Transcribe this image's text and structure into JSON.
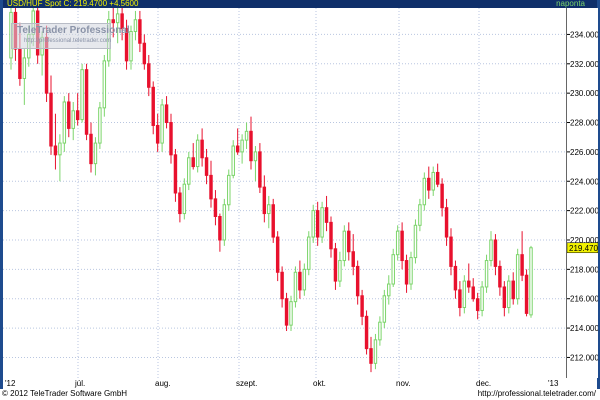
{
  "header": {
    "title": "USD/HUF Spot C: 219.4700 +4.5600",
    "period": "naponta"
  },
  "watermark": {
    "name": "TeleTrader Professional",
    "url": "http://professional.teletrader.com"
  },
  "footer": {
    "copyright": "© 2012 TeleTrader Software GmbH",
    "url": "http://professional.teletrader.com/"
  },
  "colors": {
    "frame": "#1e4b8e",
    "up": "#7cd56b",
    "down": "#e8112d",
    "grid": "#b9c6e0",
    "last_price_box": "#f2f200"
  },
  "chart_data": {
    "type": "candlestick",
    "title": "USD/HUF Spot C: 219.4700 +4.5600",
    "ylim": [
      210.6,
      235.8
    ],
    "y_ticks": [
      212,
      214,
      216,
      218,
      220,
      222,
      224,
      226,
      228,
      230,
      232,
      234
    ],
    "y_tick_labels": [
      "212.0000",
      "214.0000",
      "216.0000",
      "218.0000",
      "220.0000",
      "222.0000",
      "224.0000",
      "226.0000",
      "228.0000",
      "230.0000",
      "232.0000",
      "234.0000"
    ],
    "x_tick_labels": [
      "'12",
      "júl.",
      "aug.",
      "szept.",
      "okt.",
      "nov.",
      "dec.",
      "'13"
    ],
    "grid": true,
    "last_price": 219.47,
    "last_price_label": "219.4700",
    "candles": [
      [
        232.4,
        236.2,
        231.6,
        235.5
      ],
      [
        235.5,
        236.4,
        232.2,
        233.0
      ],
      [
        233.0,
        234.8,
        230.5,
        231.0
      ],
      [
        231.0,
        233.0,
        229.2,
        232.4
      ],
      [
        232.4,
        234.6,
        231.8,
        234.0
      ],
      [
        234.0,
        236.0,
        233.2,
        235.6
      ],
      [
        235.6,
        236.0,
        232.0,
        232.6
      ],
      [
        232.6,
        234.2,
        231.2,
        233.8
      ],
      [
        233.8,
        234.6,
        229.4,
        230.0
      ],
      [
        230.0,
        231.2,
        225.8,
        226.4
      ],
      [
        226.4,
        228.6,
        224.8,
        225.8
      ],
      [
        225.8,
        227.2,
        224.0,
        226.6
      ],
      [
        226.6,
        229.8,
        226.0,
        229.4
      ],
      [
        229.4,
        230.0,
        227.0,
        227.6
      ],
      [
        227.6,
        229.4,
        226.8,
        228.8
      ],
      [
        228.8,
        230.0,
        227.8,
        228.2
      ],
      [
        228.2,
        232.0,
        228.0,
        231.6
      ],
      [
        231.6,
        232.0,
        226.8,
        227.2
      ],
      [
        227.2,
        228.0,
        224.6,
        225.2
      ],
      [
        225.2,
        227.0,
        224.4,
        226.6
      ],
      [
        226.6,
        229.4,
        226.2,
        229.0
      ],
      [
        229.0,
        232.6,
        228.4,
        232.2
      ],
      [
        232.2,
        235.6,
        231.8,
        235.0
      ],
      [
        235.0,
        236.0,
        233.8,
        234.8
      ],
      [
        234.8,
        236.0,
        233.4,
        235.4
      ],
      [
        235.4,
        236.2,
        233.6,
        234.4
      ],
      [
        234.4,
        235.0,
        231.6,
        232.2
      ],
      [
        232.2,
        234.6,
        231.6,
        234.2
      ],
      [
        234.2,
        235.6,
        233.6,
        235.0
      ],
      [
        235.0,
        235.6,
        232.8,
        233.4
      ],
      [
        233.4,
        234.0,
        231.6,
        232.0
      ],
      [
        232.0,
        232.6,
        229.8,
        230.4
      ],
      [
        230.4,
        230.8,
        227.2,
        227.8
      ],
      [
        227.8,
        228.6,
        226.0,
        226.6
      ],
      [
        226.6,
        229.6,
        226.0,
        229.2
      ],
      [
        229.2,
        229.8,
        227.6,
        228.0
      ],
      [
        228.0,
        228.6,
        225.2,
        225.8
      ],
      [
        225.8,
        226.2,
        222.6,
        223.2
      ],
      [
        223.2,
        223.6,
        221.2,
        221.8
      ],
      [
        221.8,
        224.2,
        221.4,
        223.8
      ],
      [
        223.8,
        226.0,
        223.4,
        225.6
      ],
      [
        225.6,
        226.6,
        224.8,
        225.0
      ],
      [
        225.0,
        227.2,
        224.6,
        226.8
      ],
      [
        226.8,
        227.6,
        225.0,
        225.6
      ],
      [
        225.6,
        226.2,
        223.8,
        224.4
      ],
      [
        224.4,
        225.4,
        222.2,
        222.8
      ],
      [
        222.8,
        223.4,
        221.0,
        221.6
      ],
      [
        221.6,
        221.8,
        219.2,
        220.0
      ],
      [
        220.0,
        222.8,
        219.6,
        222.4
      ],
      [
        222.4,
        224.8,
        222.0,
        224.4
      ],
      [
        224.4,
        226.8,
        224.2,
        226.4
      ],
      [
        226.4,
        227.6,
        225.8,
        226.0
      ],
      [
        226.0,
        227.2,
        225.2,
        226.8
      ],
      [
        226.8,
        228.0,
        226.2,
        227.4
      ],
      [
        227.4,
        228.4,
        224.8,
        225.4
      ],
      [
        225.4,
        226.4,
        224.0,
        226.0
      ],
      [
        226.0,
        226.6,
        223.2,
        223.6
      ],
      [
        223.6,
        224.4,
        221.2,
        221.8
      ],
      [
        221.8,
        223.0,
        220.8,
        222.4
      ],
      [
        222.4,
        222.8,
        219.8,
        220.2
      ],
      [
        220.2,
        220.6,
        217.2,
        217.8
      ],
      [
        217.8,
        218.2,
        215.4,
        216.0
      ],
      [
        216.0,
        216.4,
        213.8,
        214.2
      ],
      [
        214.2,
        216.2,
        213.8,
        215.8
      ],
      [
        215.8,
        218.2,
        215.4,
        217.8
      ],
      [
        217.8,
        218.6,
        216.0,
        216.6
      ],
      [
        216.6,
        218.4,
        216.2,
        218.0
      ],
      [
        218.0,
        220.6,
        217.6,
        220.2
      ],
      [
        220.2,
        222.4,
        219.8,
        222.0
      ],
      [
        222.0,
        222.6,
        219.6,
        220.2
      ],
      [
        220.2,
        222.6,
        219.8,
        222.2
      ],
      [
        222.2,
        223.0,
        220.6,
        221.2
      ],
      [
        221.2,
        221.6,
        218.8,
        219.4
      ],
      [
        219.4,
        219.8,
        216.6,
        217.2
      ],
      [
        217.2,
        219.2,
        216.8,
        218.6
      ],
      [
        218.6,
        221.0,
        218.2,
        220.6
      ],
      [
        220.6,
        221.2,
        218.6,
        219.2
      ],
      [
        219.2,
        220.4,
        217.6,
        218.2
      ],
      [
        218.2,
        218.6,
        215.6,
        216.2
      ],
      [
        216.2,
        216.6,
        214.2,
        214.8
      ],
      [
        214.8,
        215.2,
        212.2,
        212.6
      ],
      [
        212.6,
        213.4,
        211.0,
        211.6
      ],
      [
        211.6,
        213.6,
        211.2,
        213.2
      ],
      [
        213.2,
        214.8,
        212.8,
        214.4
      ],
      [
        214.4,
        216.6,
        214.0,
        216.2
      ],
      [
        216.2,
        217.6,
        215.6,
        217.0
      ],
      [
        217.0,
        219.4,
        216.8,
        219.0
      ],
      [
        219.0,
        221.0,
        218.6,
        220.6
      ],
      [
        220.6,
        221.2,
        218.0,
        218.6
      ],
      [
        218.6,
        219.0,
        216.4,
        217.0
      ],
      [
        217.0,
        219.2,
        216.6,
        218.8
      ],
      [
        218.8,
        221.4,
        218.4,
        221.0
      ],
      [
        221.0,
        222.8,
        220.6,
        222.4
      ],
      [
        222.4,
        224.6,
        222.0,
        224.2
      ],
      [
        224.2,
        225.0,
        222.8,
        223.4
      ],
      [
        223.4,
        225.0,
        223.0,
        224.6
      ],
      [
        224.6,
        225.2,
        223.6,
        223.8
      ],
      [
        223.8,
        224.2,
        221.6,
        222.2
      ],
      [
        222.2,
        222.8,
        219.6,
        220.2
      ],
      [
        220.2,
        220.8,
        217.6,
        218.2
      ],
      [
        218.2,
        218.6,
        216.0,
        216.6
      ],
      [
        216.6,
        217.2,
        214.8,
        215.4
      ],
      [
        215.4,
        217.6,
        215.0,
        217.2
      ],
      [
        217.2,
        218.4,
        216.4,
        216.8
      ],
      [
        216.8,
        217.4,
        215.8,
        216.0
      ],
      [
        216.0,
        216.4,
        214.6,
        215.2
      ],
      [
        215.2,
        217.2,
        214.8,
        216.8
      ],
      [
        216.8,
        219.0,
        216.4,
        218.6
      ],
      [
        218.6,
        220.6,
        218.2,
        220.0
      ],
      [
        220.0,
        220.4,
        217.6,
        218.2
      ],
      [
        218.2,
        218.6,
        216.2,
        216.8
      ],
      [
        216.8,
        217.2,
        214.8,
        215.4
      ],
      [
        215.4,
        217.6,
        215.0,
        217.2
      ],
      [
        217.2,
        217.8,
        215.6,
        216.0
      ],
      [
        216.0,
        219.4,
        215.6,
        219.0
      ],
      [
        219.0,
        220.6,
        217.2,
        217.6
      ],
      [
        217.6,
        218.0,
        214.8,
        215.0
      ],
      [
        214.9,
        219.6,
        214.7,
        219.47
      ]
    ]
  }
}
